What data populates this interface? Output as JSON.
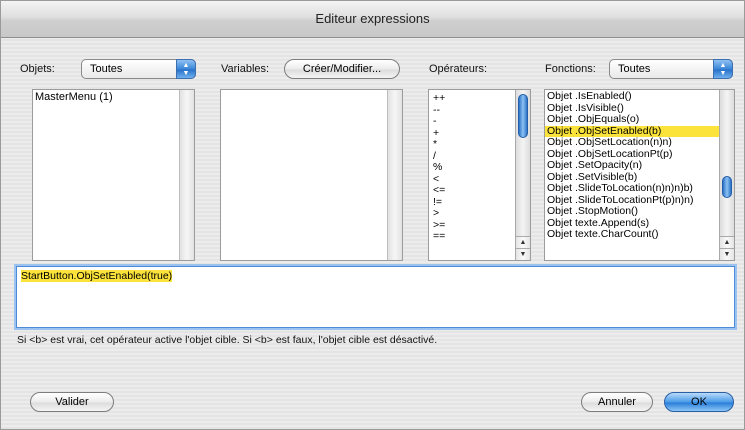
{
  "window": {
    "title": "Editeur expressions"
  },
  "objets": {
    "label": "Objets:",
    "selected": "Toutes",
    "items": [
      "MasterMenu (1)"
    ]
  },
  "variables": {
    "label": "Variables:",
    "button_label": "Créer/Modifier...",
    "items": []
  },
  "operateurs": {
    "label": "Opérateurs:",
    "items": [
      "++",
      "--",
      "-",
      "+",
      "*",
      "/",
      "%",
      "<",
      "<=",
      "!=",
      ">",
      ">=",
      "=="
    ]
  },
  "fonctions": {
    "label": "Fonctions:",
    "selected": "Toutes",
    "items": [
      "Objet .IsEnabled()",
      "Objet .IsVisible()",
      "Objet .ObjEquals(o)",
      "Objet .ObjSetEnabled(b)",
      "Objet .ObjSetLocation(n)n)",
      "Objet .ObjSetLocationPt(p)",
      "Objet .SetOpacity(n)",
      "Objet .SetVisible(b)",
      "Objet .SlideToLocation(n)n)n)b)",
      "Objet .SlideToLocationPt(p)n)n)",
      "Objet .StopMotion()",
      "Objet texte.Append(s)",
      "Objet texte.CharCount()"
    ],
    "selected_index": 3
  },
  "editor": {
    "expression": "StartButton.ObjSetEnabled(true)"
  },
  "description": "Si <b> est vrai, cet opérateur active l'objet cible. Si <b> est faux, l'objet cible est désactivé.",
  "buttons": {
    "valider": "Valider",
    "annuler": "Annuler",
    "ok": "OK"
  },
  "icons": {
    "popup_arrows": "up-down-arrows-icon",
    "scroll_up": "scroll-up-arrow-icon",
    "scroll_down": "scroll-down-arrow-icon"
  },
  "colors": {
    "selection": "#fbe33b",
    "accent": "#3a86d8"
  }
}
